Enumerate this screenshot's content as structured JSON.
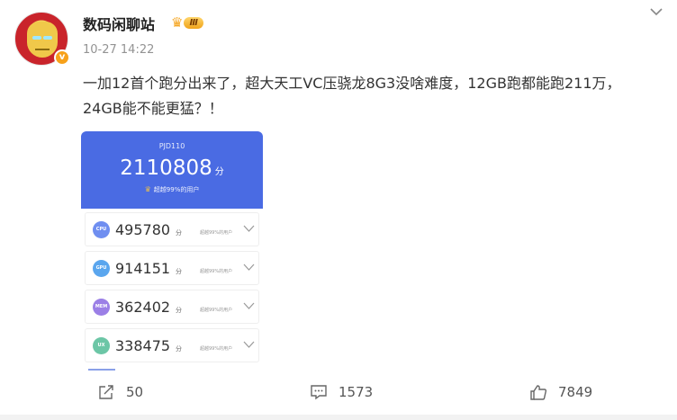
{
  "post": {
    "author": "数码闲聊站",
    "level": "Ⅲ",
    "verified_mark": "v",
    "timestamp": "10-27 14:22",
    "text": "一加12首个跑分出来了，超大天工VC压骁龙8G3没啥难度，12GB跑都能跑211万，24GB能不能更猛？！"
  },
  "benchmark": {
    "device": "PJD110",
    "total": "2110808",
    "unit": "分",
    "rank": "超越99%的用户",
    "header_color": "#4a6be3",
    "rows": [
      {
        "label": "CPU",
        "score": "495780",
        "unit": "分",
        "rank": "超越99%的用户",
        "color": "#6f8ef0"
      },
      {
        "label": "GPU",
        "score": "914151",
        "unit": "分",
        "rank": "超越99%的用户",
        "color": "#5aa6ee"
      },
      {
        "label": "MEM",
        "score": "362402",
        "unit": "分",
        "rank": "超越99%的用户",
        "color": "#9b7fe6"
      },
      {
        "label": "UX",
        "score": "338475",
        "unit": "分",
        "rank": "超越99%的用户",
        "color": "#6cc6a6"
      }
    ]
  },
  "actions": {
    "share_count": "50",
    "comment_count": "1573",
    "like_count": "7849"
  },
  "icons": [
    "chevron-down-icon",
    "share-icon",
    "comment-icon",
    "like-icon",
    "crown-icon"
  ]
}
